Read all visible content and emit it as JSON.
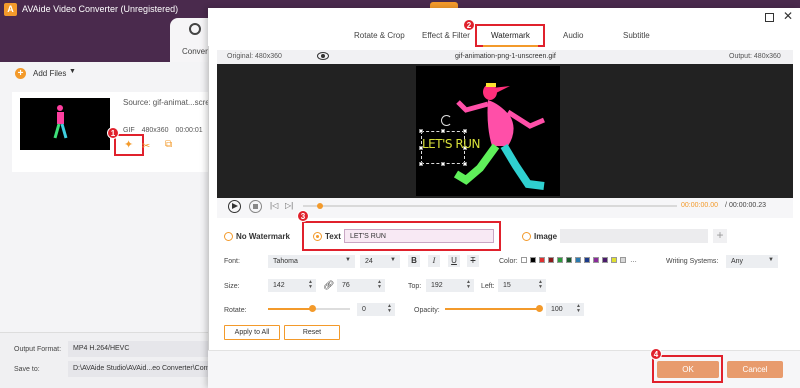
{
  "app": {
    "title": "AVAide Video Converter (Unregistered)",
    "logo": "A"
  },
  "main": {
    "converter_tab": "Converter",
    "add_files": "Add Files",
    "file": {
      "source": "Source: gif-animat...screen.gif",
      "format": "GIF",
      "resolution": "480x360",
      "duration": "00:00:01"
    },
    "output_format_label": "Output Format:",
    "output_format_value": "MP4 H.264/HEVC",
    "save_to_label": "Save to:",
    "save_to_value": "D:\\AVAide Studio\\AVAid...eo Converter\\Converted"
  },
  "dialog": {
    "tabs": [
      "Rotate & Crop",
      "Effect & Filter",
      "Watermark",
      "Audio",
      "Subtitle"
    ],
    "active_tab": "Watermark",
    "original": "Original: 480x360",
    "filename": "gif-animation-png-1-unscreen.gif",
    "output": "Output: 480x360",
    "watermark_preview_text": "LET'S RUN",
    "time_current": "00:00:00.00",
    "time_separator": "/",
    "time_total": "00:00:00.23",
    "no_watermark": "No Watermark",
    "text_label": "Text",
    "text_value": "LET'S RUN",
    "image_label": "Image",
    "image_add": "+",
    "font_label": "Font:",
    "font_value": "Tahoma",
    "font_size_value": "24",
    "bold": "B",
    "italic": "I",
    "underline": "U",
    "strike": "T",
    "color_label": "Color:",
    "swatches": [
      "#ffffff",
      "#000000",
      "#e03030",
      "#8b1a1a",
      "#2a9a3a",
      "#1a5a2a",
      "#2a7ab0",
      "#1a3a8a",
      "#8a2a9a",
      "#4a1a6a",
      "#e0e030",
      "#d8d8d8"
    ],
    "writing_label": "Writing Systems:",
    "writing_value": "Any",
    "size_label": "Size:",
    "width_value": "142",
    "height_value": "76",
    "top_label": "Top:",
    "top_value": "192",
    "left_label": "Left:",
    "left_value": "15",
    "rotate_label": "Rotate:",
    "rotate_value": "0",
    "opacity_label": "Opacity:",
    "opacity_value": "100",
    "apply_all": "Apply to All",
    "reset": "Reset",
    "ok": "OK",
    "cancel": "Cancel"
  },
  "steps": [
    "1",
    "2",
    "3",
    "4"
  ],
  "colors": {
    "accent": "#f39a2b",
    "highlight": "#e0212c",
    "titlebar": "#4a2a4d",
    "ok_button": "#e89b6d"
  }
}
